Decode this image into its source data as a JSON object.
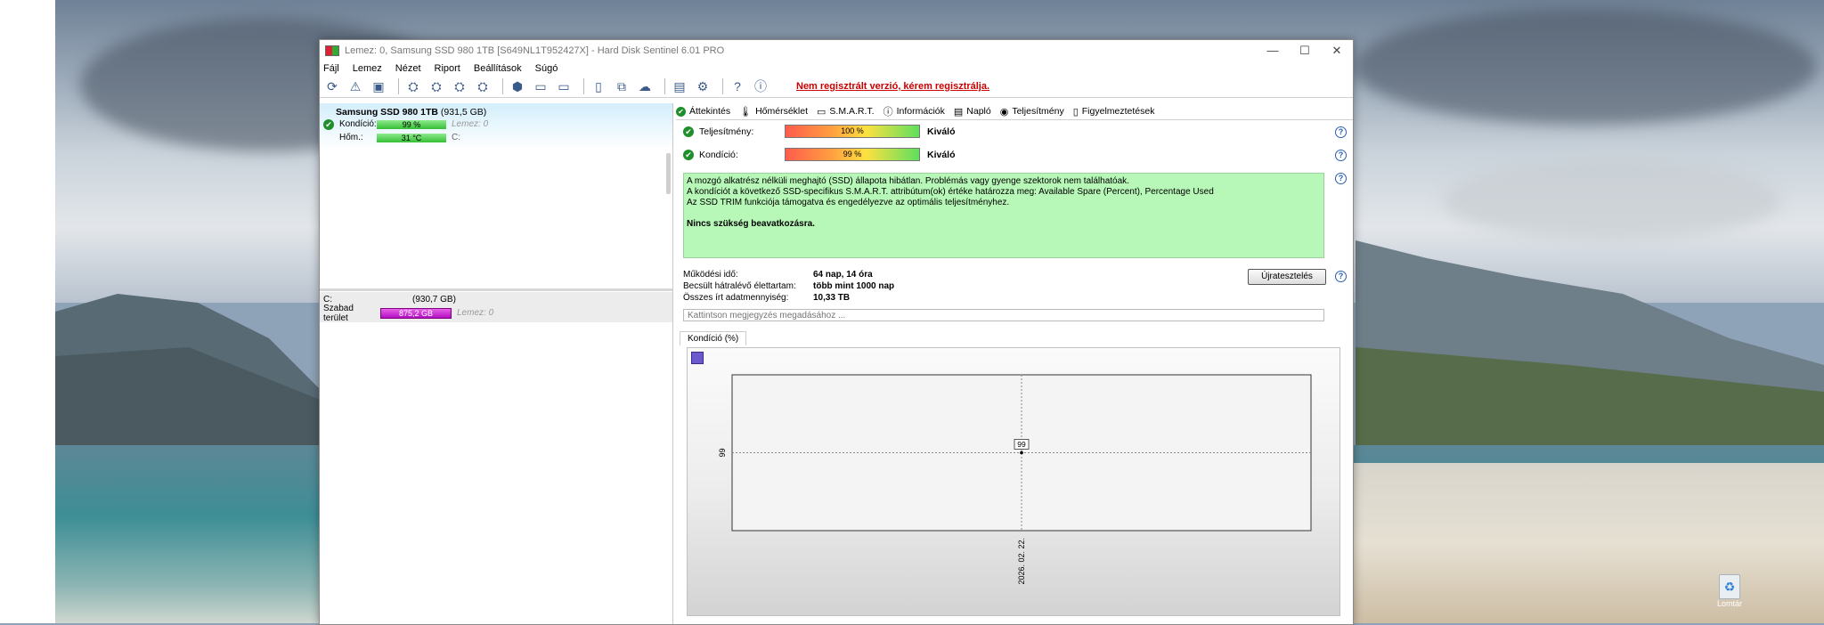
{
  "window": {
    "title": "Lemez: 0, Samsung SSD 980 1TB [S649NL1T952427X]  -  Hard Disk Sentinel 6.01 PRO"
  },
  "menu": [
    "Fájl",
    "Lemez",
    "Nézet",
    "Riport",
    "Beállítások",
    "Súgó"
  ],
  "toolbar": {
    "warning": "Nem regisztrált verzió, kérem regisztrálja."
  },
  "left": {
    "disk_name": "Samsung SSD 980 1TB",
    "disk_size": "(931,5 GB)",
    "condition_label": "Kondíció:",
    "condition_value": "99 %",
    "condition_disk": "Lemez: 0",
    "temp_label": "Hőm.:",
    "temp_value": "31 °C",
    "temp_volume": "C:",
    "volume_name": "C:",
    "volume_size": "(930,7 GB)",
    "free_label": "Szabad terület",
    "free_value": "875,2 GB",
    "free_disk": "Lemez: 0"
  },
  "tabs": [
    "Áttekintés",
    "Hőmérséklet",
    "S.M.A.R.T.",
    "Információk",
    "Napló",
    "Teljesítmény",
    "Figyelmeztetések"
  ],
  "overview": {
    "performance_label": "Teljesítmény:",
    "performance_value": "100 %",
    "performance_rating": "Kiváló",
    "condition_label": "Kondíció:",
    "condition_value": "99 %",
    "condition_rating": "Kiváló",
    "info_lines": [
      "A mozgó alkatrész nélküli meghajtó (SSD) állapota hibátlan. Problémás vagy gyenge szektorok nem találhatóak.",
      "A kondíciót a következő SSD-specifikus S.M.A.R.T. attribútum(ok) értéke határozza meg:  Available Spare (Percent), Percentage Used",
      "Az SSD TRIM funkciója támogatva és engedélyezve az optimális teljesítményhez."
    ],
    "info_strong": "Nincs szükség beavatkozásra.",
    "uptime_label": "Működési idő:",
    "uptime_value": "64 nap, 14 óra",
    "lifetime_label": "Becsült hátralévő élettartam:",
    "lifetime_value": "több mint 1000 nap",
    "written_label": "Összes írt adatmennyiség:",
    "written_value": "10,33 TB",
    "reset_button": "Újratesztelés",
    "note_placeholder": "Kattintson megjegyzés megadásához ...",
    "chart_tab": "Kondíció  (%)"
  },
  "colors": {
    "ok_green": "#1f8f2c",
    "info_bg": "#b7f7b7",
    "warning_red": "#cc0000",
    "free_magenta": "#c020d0"
  },
  "chart_data": {
    "type": "line",
    "title": "",
    "x": [
      "2026. 02. 22."
    ],
    "series": [
      {
        "values": [
          99
        ]
      }
    ],
    "y_tick": "99",
    "data_label": "99",
    "grid": true
  }
}
